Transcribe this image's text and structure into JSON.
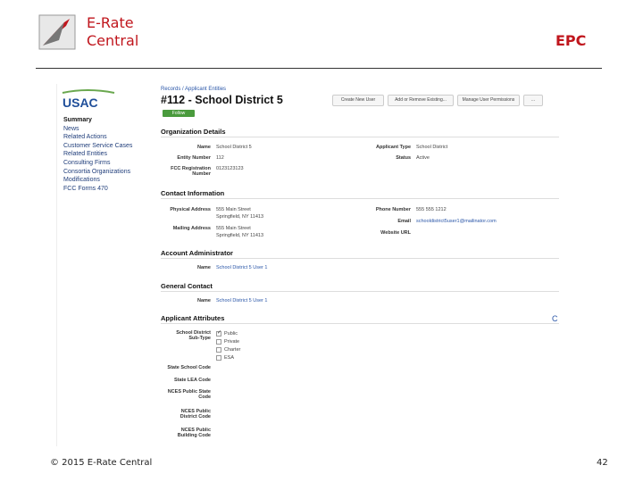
{
  "brand": {
    "line1": "E-Rate",
    "line2": "Central",
    "right_tag": "EPC"
  },
  "footer": {
    "copyright": "© 2015 E-Rate Central",
    "page": "42"
  },
  "usac_logo": "USAC",
  "sidebar": [
    "Summary",
    "News",
    "Related Actions",
    "Customer Service Cases",
    "Related Entities",
    "Consulting Firms",
    "Consortia Organizations",
    "Modifications",
    "FCC Forms 470"
  ],
  "crumb": "Records / Applicant Entities",
  "title": "#112 - School District 5",
  "badge": "Follow",
  "tabs": [
    "Create New User",
    "Add or Remove Existing...",
    "Manage User Permissions",
    "..."
  ],
  "org": {
    "heading": "Organization Details",
    "name_lbl": "Name",
    "name": "School District 5",
    "entity_lbl": "Entity Number",
    "entity": "112",
    "fcc_lbl1": "FCC Registration",
    "fcc_lbl2": "Number",
    "fcc": "0123123123",
    "type_lbl": "Applicant Type",
    "type": "School District",
    "status_lbl": "Status",
    "status": "Active"
  },
  "contact": {
    "heading": "Contact Information",
    "phys_lbl": "Physical Address",
    "phys1": "555 Main Street",
    "phys2": "Springfield, NY 11413",
    "mail_lbl": "Mailing Address",
    "mail1": "555 Main Street",
    "mail2": "Springfield, NY 11413",
    "phone_lbl": "Phone Number",
    "phone": "555 555 1212",
    "email_lbl": "Email",
    "email": "schooldistrict5user1@mailinator.com",
    "web_lbl": "Website URL"
  },
  "admin": {
    "heading": "Account Administrator",
    "name_lbl": "Name",
    "name": "School District 5 User 1"
  },
  "general": {
    "heading": "General Contact",
    "name_lbl": "Name",
    "name": "School District 5 User 1"
  },
  "attrs": {
    "heading": "Applicant Attributes",
    "sd_lbl1": "School District",
    "sd_lbl2": "Sub-Type",
    "opts": [
      "Public",
      "Private",
      "Charter",
      "ESA"
    ],
    "state_code": "State School Code",
    "lea_code": "State LEA Code",
    "nces_state1": "NCES Public State",
    "nces_state2": "Code",
    "nces_dist1": "NCES Public",
    "nces_dist2": "District Code",
    "nces_build1": "NCES Public",
    "nces_build2": "Building Code"
  },
  "colors": {
    "brand": "#c0161d",
    "link": "#2a56a8",
    "badge": "#4a9b3d"
  }
}
